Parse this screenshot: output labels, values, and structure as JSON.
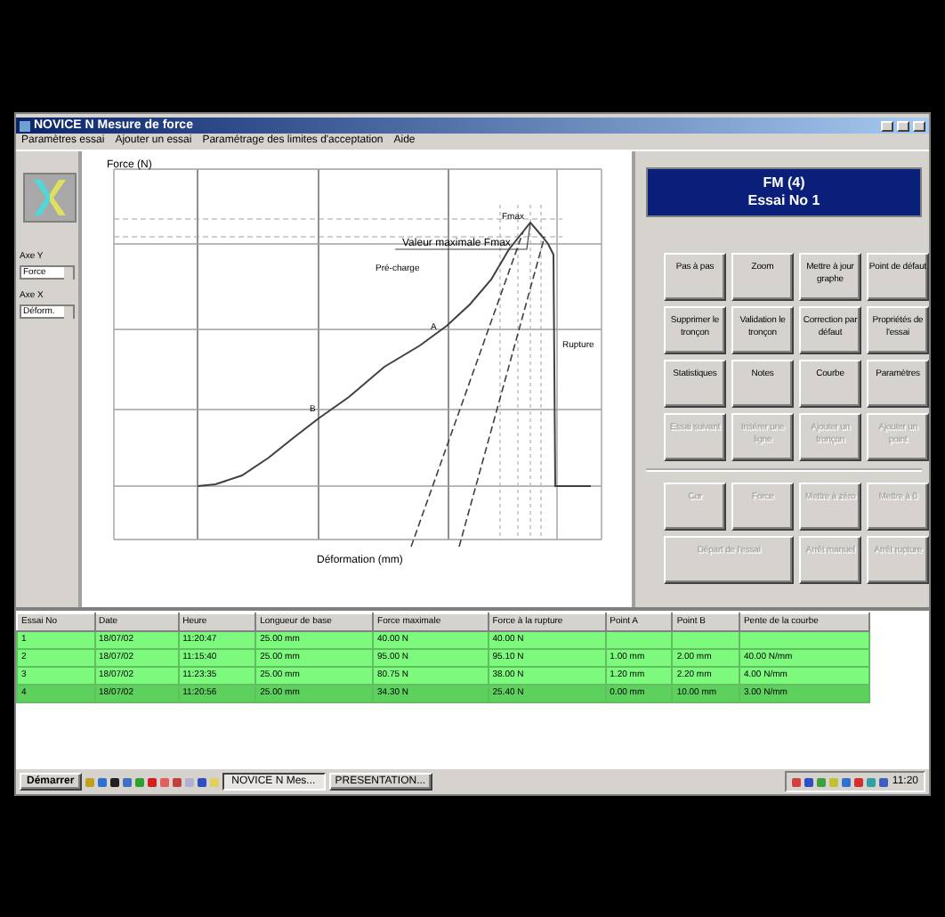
{
  "window": {
    "title": "NOVICE N Mesure de force"
  },
  "menu": [
    "Paramètres essai",
    "Ajouter un essai",
    "Paramétrage des limites d'acceptation",
    "Aide"
  ],
  "axes_panel": [
    {
      "label": "Axe Y",
      "value": "Force"
    },
    {
      "label": "Axe X",
      "value": "Déform."
    }
  ],
  "chart": {
    "ylabel": "Force (N)",
    "xlabel": "Déformation (mm)",
    "annotations": [
      {
        "text": "Valeur maximale Fmax"
      },
      {
        "text": "Fmax"
      },
      {
        "text": "Pré-charge"
      },
      {
        "text": "Rupture"
      },
      {
        "text": "A"
      },
      {
        "text": "B"
      }
    ]
  },
  "header": {
    "line1": "FM (4)",
    "line2": "Essai No 1"
  },
  "buttons": [
    {
      "label": "Pas à pas",
      "disabled": false
    },
    {
      "label": "Zoom",
      "disabled": false
    },
    {
      "label": "Mettre à jour graphe",
      "disabled": false
    },
    {
      "label": "Point de défaut",
      "disabled": false
    },
    {
      "label": "Supprimer le tronçon",
      "disabled": false
    },
    {
      "label": "Validation le tronçon",
      "disabled": false
    },
    {
      "label": "Correction par défaut",
      "disabled": false
    },
    {
      "label": "Propriétés de l'essai",
      "disabled": false
    },
    {
      "label": "Statistiques",
      "disabled": false
    },
    {
      "label": "Notes",
      "disabled": false
    },
    {
      "label": "Courbe",
      "disabled": false
    },
    {
      "label": "Paramètres",
      "disabled": false
    },
    {
      "label": "Essai suivant",
      "disabled": true
    },
    {
      "label": "Insérer une ligne",
      "disabled": true
    },
    {
      "label": "Ajouter un tronçon",
      "disabled": true
    },
    {
      "label": "Ajouter un point",
      "disabled": true
    }
  ],
  "buttons_lower": [
    {
      "label": "Cor",
      "disabled": true,
      "kind": "single"
    },
    {
      "label": "Force",
      "disabled": true,
      "kind": "single"
    },
    {
      "label": "Mettre à zéro",
      "disabled": true,
      "kind": "single"
    },
    {
      "label": "Mettre à 0",
      "disabled": true,
      "kind": "single"
    },
    {
      "label": "Départ de l'essai",
      "disabled": true,
      "kind": "wide"
    },
    {
      "label": "Arrêt manuel",
      "disabled": true,
      "kind": "single"
    },
    {
      "label": "Arrêt rupture",
      "disabled": true,
      "kind": "single"
    }
  ],
  "table": {
    "columns": [
      "Essai No",
      "Date",
      "Heure",
      "Longueur de base",
      "Force maximale",
      "Force à la rupture",
      "Point A",
      "Point B",
      "Pente de la courbe"
    ],
    "rows": [
      {
        "cells": [
          "1",
          "18/07/02",
          "11:20:47",
          "25.00 mm",
          "40.00 N",
          "40.00 N",
          "",
          "",
          ""
        ],
        "selected": false
      },
      {
        "cells": [
          "2",
          "18/07/02",
          "11:15:40",
          "25.00 mm",
          "95.00 N",
          "95.10 N",
          "1.00 mm",
          "2.00 mm",
          "40.00 N/mm"
        ],
        "selected": false
      },
      {
        "cells": [
          "3",
          "18/07/02",
          "11:23:35",
          "25.00 mm",
          "80.75 N",
          "38.00 N",
          "1.20 mm",
          "2.20 mm",
          "4.00 N/mm"
        ],
        "selected": false
      },
      {
        "cells": [
          "4",
          "18/07/02",
          "11:20:56",
          "25.00 mm",
          "34.30 N",
          "25.40 N",
          "0.00 mm",
          "10.00 mm",
          "3.00 N/mm"
        ],
        "selected": true
      }
    ]
  },
  "taskbar": {
    "start": "Démarrer",
    "tasks": [
      {
        "label": "NOVICE N Mes...",
        "selected": true
      },
      {
        "label": "PRESENTATION...",
        "selected": false
      }
    ],
    "clock": "11:20"
  }
}
